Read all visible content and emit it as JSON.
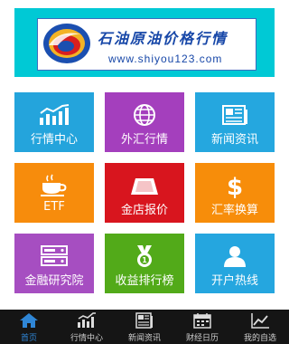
{
  "banner": {
    "title": "石油原油价格行情",
    "url": "www.shiyou123.com",
    "logo_icon": "oil-drop-logo"
  },
  "tiles": [
    {
      "label": "行情中心",
      "icon": "bar-chart-icon",
      "color": "#24a4dc"
    },
    {
      "label": "外汇行情",
      "icon": "globe-icon",
      "color": "#a43fbd"
    },
    {
      "label": "新闻资讯",
      "icon": "newspaper-icon",
      "color": "#25a7df"
    },
    {
      "label": "ETF",
      "icon": "coffee-cup-icon",
      "color": "#f78c0c"
    },
    {
      "label": "金店报价",
      "icon": "gold-bar-icon",
      "color": "#d8151e"
    },
    {
      "label": "汇率换算",
      "icon": "dollar-icon",
      "color": "#f78d0a"
    },
    {
      "label": "金融研究院",
      "icon": "server-icon",
      "color": "#a64ec1"
    },
    {
      "label": "收益排行榜",
      "icon": "medal-icon",
      "color": "#52aa19"
    },
    {
      "label": "开户热线",
      "icon": "person-icon",
      "color": "#25a6df"
    }
  ],
  "tabbar": {
    "active_index": 0,
    "active_color": "#2f86d6",
    "items": [
      {
        "label": "首页",
        "icon": "home-icon"
      },
      {
        "label": "行情中心",
        "icon": "bar-chart-icon"
      },
      {
        "label": "新闻资讯",
        "icon": "newspaper-icon"
      },
      {
        "label": "财经日历",
        "icon": "calendar-icon"
      },
      {
        "label": "我的自选",
        "icon": "trend-chart-icon"
      }
    ]
  }
}
